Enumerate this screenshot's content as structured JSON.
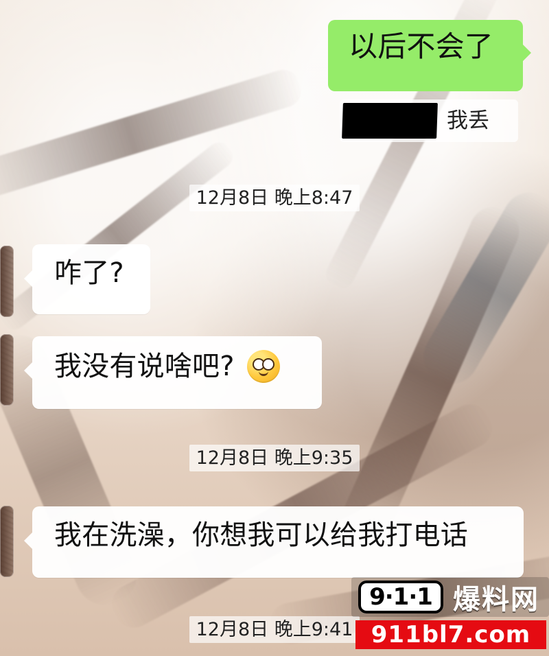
{
  "messages": {
    "outgoing_1": "以后不会了",
    "quote_text": "我丢",
    "time_1": "12月8日 晚上8:47",
    "incoming_1": "咋了?",
    "incoming_2": "我没有说啥吧?",
    "time_2": "12月8日 晚上9:35",
    "incoming_3": "我在洗澡，你想我可以给我打电话",
    "time_3": "12月8日 晚上9:41"
  },
  "watermark": {
    "badge_text": "9·1·1",
    "brand_text": "爆料网",
    "url_text": "911bl7.com"
  },
  "icons": {
    "emoji": "flushed-face-icon"
  },
  "colors": {
    "outgoing_bubble": "#95ec69",
    "incoming_bubble": "#ffffff",
    "watermark_red": "#e50b12"
  }
}
